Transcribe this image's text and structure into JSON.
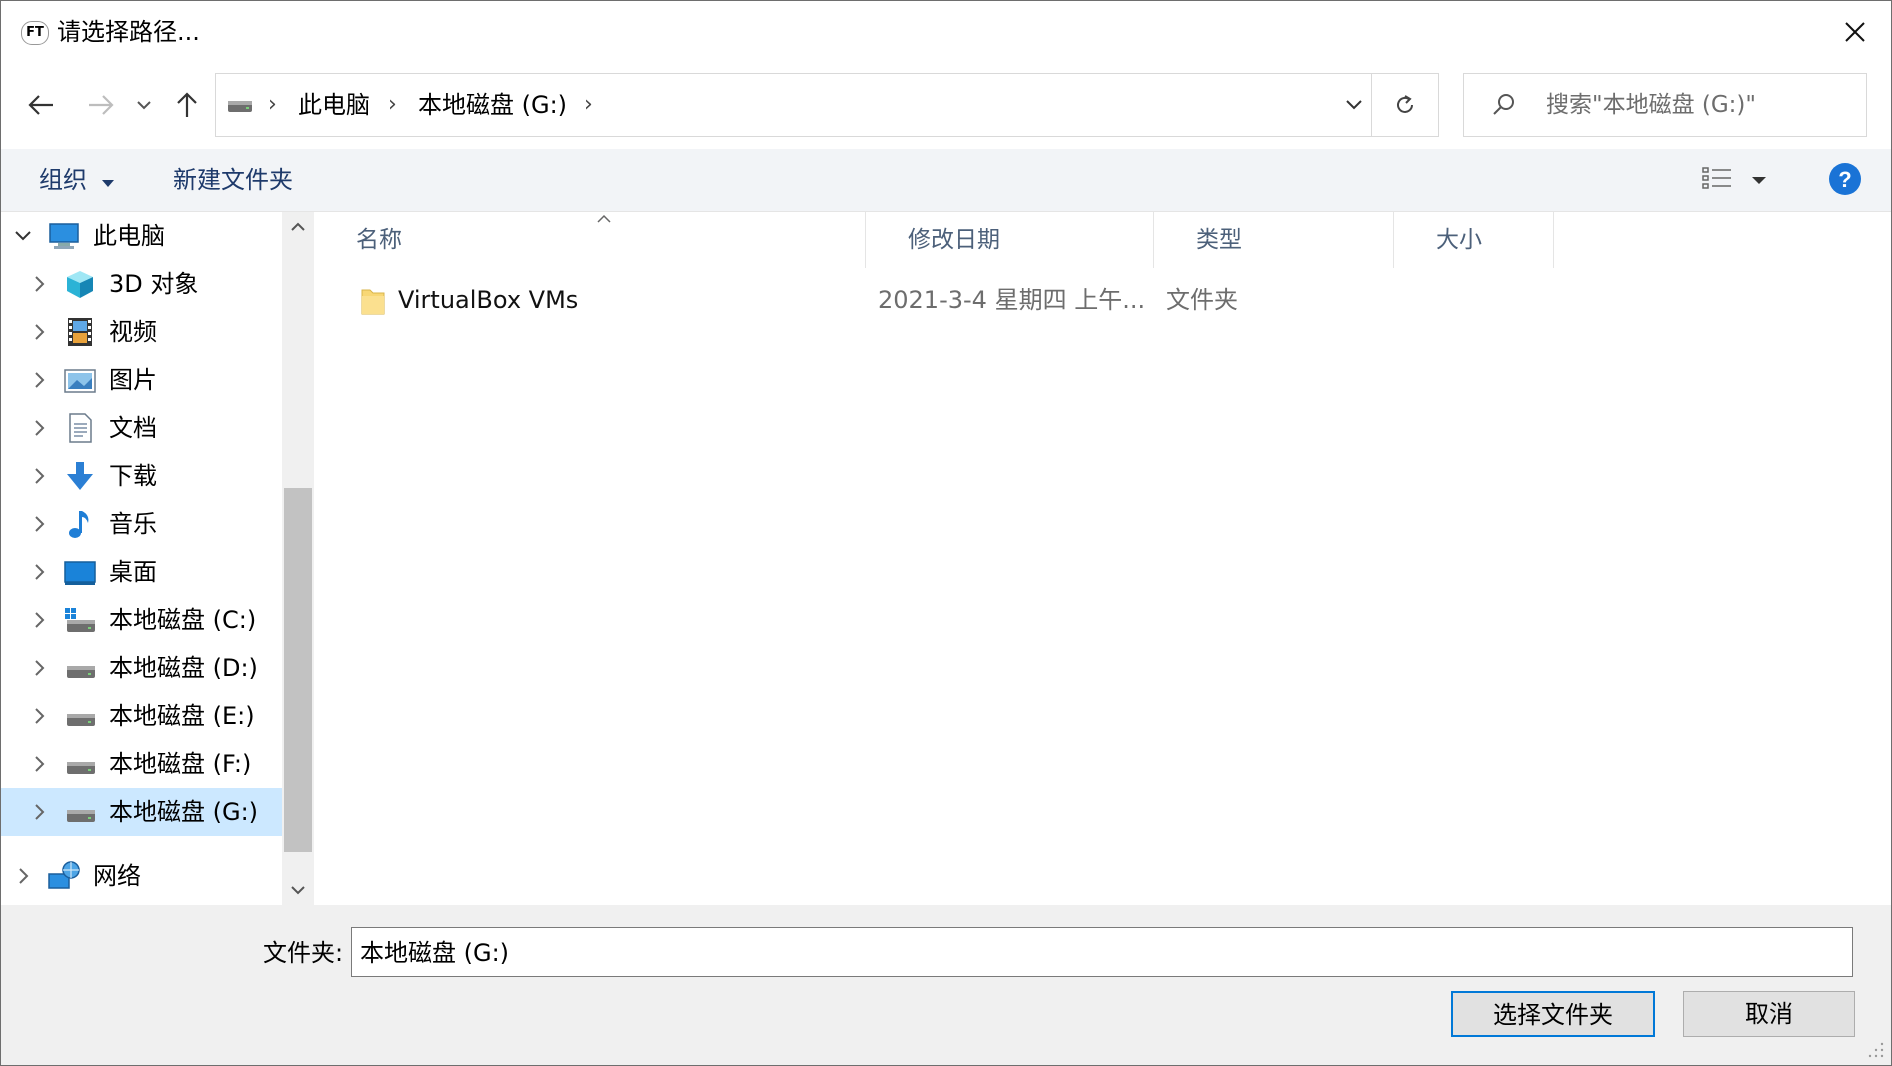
{
  "window": {
    "app_icon_text": "FT",
    "title": "请选择路径..."
  },
  "address": {
    "crumbs": [
      "此电脑",
      "本地磁盘 (G:)"
    ]
  },
  "search": {
    "placeholder": "搜索\"本地磁盘 (G:)\""
  },
  "toolbar": {
    "organize": "组织",
    "new_folder": "新建文件夹"
  },
  "nav_tree": [
    {
      "label": "此电脑",
      "icon": "computer-icon",
      "expanded": true
    },
    {
      "label": "3D 对象",
      "icon": "3d-objects-icon"
    },
    {
      "label": "视频",
      "icon": "videos-icon"
    },
    {
      "label": "图片",
      "icon": "pictures-icon"
    },
    {
      "label": "文档",
      "icon": "documents-icon"
    },
    {
      "label": "下载",
      "icon": "downloads-icon"
    },
    {
      "label": "音乐",
      "icon": "music-icon"
    },
    {
      "label": "桌面",
      "icon": "desktop-icon"
    },
    {
      "label": "本地磁盘 (C:)",
      "icon": "system-drive-icon"
    },
    {
      "label": "本地磁盘 (D:)",
      "icon": "drive-icon"
    },
    {
      "label": "本地磁盘 (E:)",
      "icon": "drive-icon"
    },
    {
      "label": "本地磁盘 (F:)",
      "icon": "drive-icon"
    },
    {
      "label": "本地磁盘 (G:)",
      "icon": "drive-icon",
      "selected": true
    },
    {
      "label": "网络",
      "icon": "network-icon"
    }
  ],
  "columns": [
    "名称",
    "修改日期",
    "类型",
    "大小"
  ],
  "files": [
    {
      "name": "VirtualBox VMs",
      "modified": "2021-3-4 星期四 上午...",
      "type": "文件夹",
      "size": ""
    }
  ],
  "bottom": {
    "folder_label": "文件夹:",
    "folder_value": "本地磁盘 (G:)",
    "select_button": "选择文件夹",
    "cancel_button": "取消"
  },
  "colors": {
    "accent": "#0078d7",
    "selected_bg": "#cce8ff",
    "toolbar_bg": "#f2f4f7",
    "help": "#1a73d6"
  }
}
